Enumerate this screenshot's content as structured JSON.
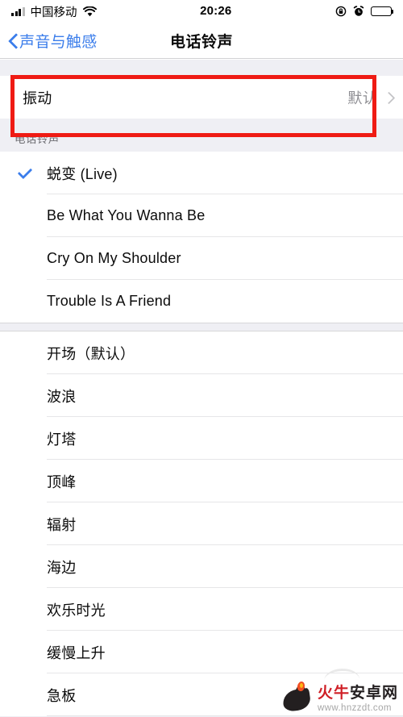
{
  "status_bar": {
    "carrier": "中国移动",
    "time": "20:26",
    "signal_bars_filled": 3,
    "signal_bars_total": 4,
    "wifi_icon": "wifi-icon",
    "rotation_lock_icon": "rotation-lock-icon",
    "alarm_icon": "alarm-clock-icon",
    "battery_icon": "battery-full-icon"
  },
  "nav_bar": {
    "back_label": "声音与触感",
    "back_icon": "chevron-left-icon",
    "title": "电话铃声"
  },
  "vibration_row": {
    "label": "振动",
    "value": "默认",
    "chevron_icon": "chevron-right-icon",
    "highlighted": true,
    "highlight_color": "#ef1b14"
  },
  "section_header": "电话铃声",
  "accent_color": "#3c7eeb",
  "selected_tone": "蜕变 (Live)",
  "check_icon": "checkmark-icon",
  "custom_tones": [
    {
      "label": "蜕变 (Live)",
      "selected": true
    },
    {
      "label": "Be What You Wanna Be",
      "selected": false
    },
    {
      "label": "Cry On My Shoulder",
      "selected": false
    },
    {
      "label": "Trouble Is A Friend",
      "selected": false
    }
  ],
  "stock_tones": [
    {
      "label": "开场（默认）",
      "selected": false
    },
    {
      "label": "波浪",
      "selected": false
    },
    {
      "label": "灯塔",
      "selected": false
    },
    {
      "label": "顶峰",
      "selected": false
    },
    {
      "label": "辐射",
      "selected": false
    },
    {
      "label": "海边",
      "selected": false
    },
    {
      "label": "欢乐时光",
      "selected": false
    },
    {
      "label": "缓慢上升",
      "selected": false
    },
    {
      "label": "急板",
      "selected": false
    }
  ],
  "watermark": {
    "name_red": "火牛",
    "name_black": "安卓网",
    "url": "www.hnzzdt.com",
    "logo_icon": "fire-bull-logo-icon"
  }
}
